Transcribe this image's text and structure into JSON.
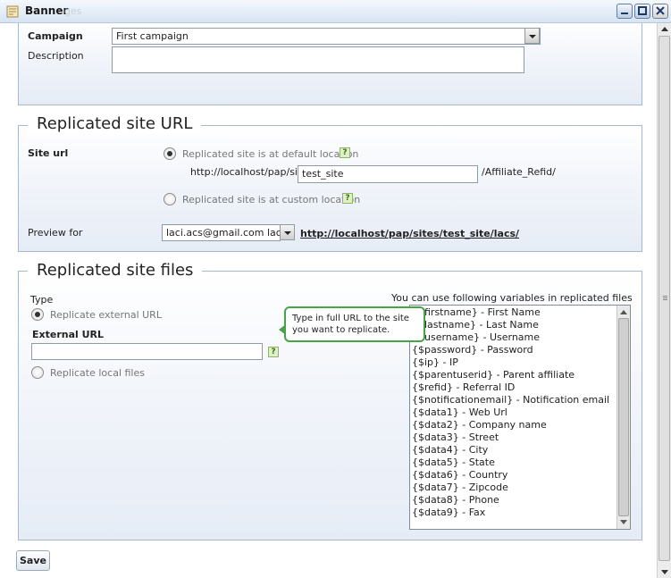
{
  "window": {
    "title": "Banner",
    "ghost_title": "ges"
  },
  "campaign_section": {
    "campaign_label": "Campaign",
    "campaign_value": "First campaign",
    "description_label": "Description",
    "description_value": ""
  },
  "site_url_section": {
    "legend": "Replicated site URL",
    "site_url_label": "Site url",
    "option_default": "Replicated site is at default location",
    "url_prefix": "http://localhost/pap/sites/",
    "site_value": "test_site",
    "url_suffix": "/Affiliate_Refid/",
    "option_custom": "Replicated site is at custom location",
    "preview_label": "Preview for",
    "preview_value": "laci.acs@gmail.com laci acs",
    "preview_link": "http://localhost/pap/sites/test_site/lacs/",
    "help_glyph": "?"
  },
  "files_section": {
    "legend": "Replicated site files",
    "type_label": "Type",
    "option_external": "Replicate external URL",
    "external_url_label": "External URL",
    "external_url_value": "",
    "option_local": "Replicate local files",
    "tooltip": "Type in full URL to the site you want to replicate.",
    "variables_heading": "You can use following variables in replicated files",
    "variables": [
      "{$firstname} - First Name",
      "{$lastname} - Last Name",
      "{$username} - Username",
      "{$password} - Password",
      "{$ip} - IP",
      "{$parentuserid} - Parent affiliate",
      "{$refid} - Referral ID",
      "{$notificationemail} - Notification email",
      "{$data1} - Web Url",
      "{$data2} - Company name",
      "{$data3} - Street",
      "{$data4} - City",
      "{$data5} - State",
      "{$data6} - Country",
      "{$data7} - Zipcode",
      "{$data8} - Phone",
      "{$data9} - Fax"
    ]
  },
  "footer": {
    "save_label": "Save"
  }
}
